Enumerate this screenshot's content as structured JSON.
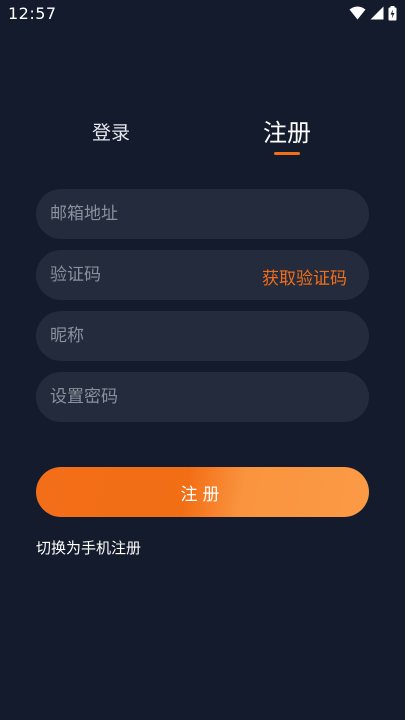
{
  "status_bar": {
    "time": "12:57",
    "icons": [
      "wifi-icon",
      "signal-icon",
      "battery-charging-icon"
    ]
  },
  "tabs": {
    "login_label": "登录",
    "register_label": "注册",
    "active": "register"
  },
  "form": {
    "email_placeholder": "邮箱地址",
    "code_placeholder": "验证码",
    "get_code_label": "获取验证码",
    "nickname_placeholder": "昵称",
    "password_placeholder": "设置密码"
  },
  "submit_label": "注册",
  "switch_label": "切换为手机注册",
  "colors": {
    "background": "#131b2c",
    "field_background": "#232b3c",
    "accent": "#f36e18",
    "placeholder": "#8a909c"
  }
}
